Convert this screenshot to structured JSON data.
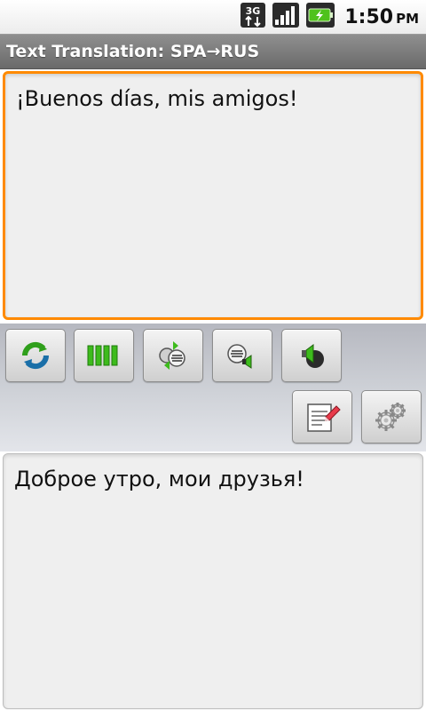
{
  "status_bar": {
    "network_label": "3G",
    "time": "1:50",
    "ampm": "PM"
  },
  "app": {
    "title": "Text Translation: SPA→RUS"
  },
  "source": {
    "text": "¡Buenos días, mis amigos!"
  },
  "target": {
    "text": "Доброе утро, мои друзья!"
  },
  "toolbar": {
    "buttons": [
      {
        "icon": "refresh-icon"
      },
      {
        "icon": "dictionary-bars-icon"
      },
      {
        "icon": "translate-text-icon"
      },
      {
        "icon": "speak-text-icon"
      },
      {
        "icon": "speaker-icon"
      },
      {
        "icon": "clear-edit-icon"
      },
      {
        "icon": "settings-gears-icon"
      }
    ]
  },
  "colors": {
    "focus_border": "#ff8a00",
    "title_bar": "#7a7a7a",
    "accent_green": "#3dbb1c"
  }
}
